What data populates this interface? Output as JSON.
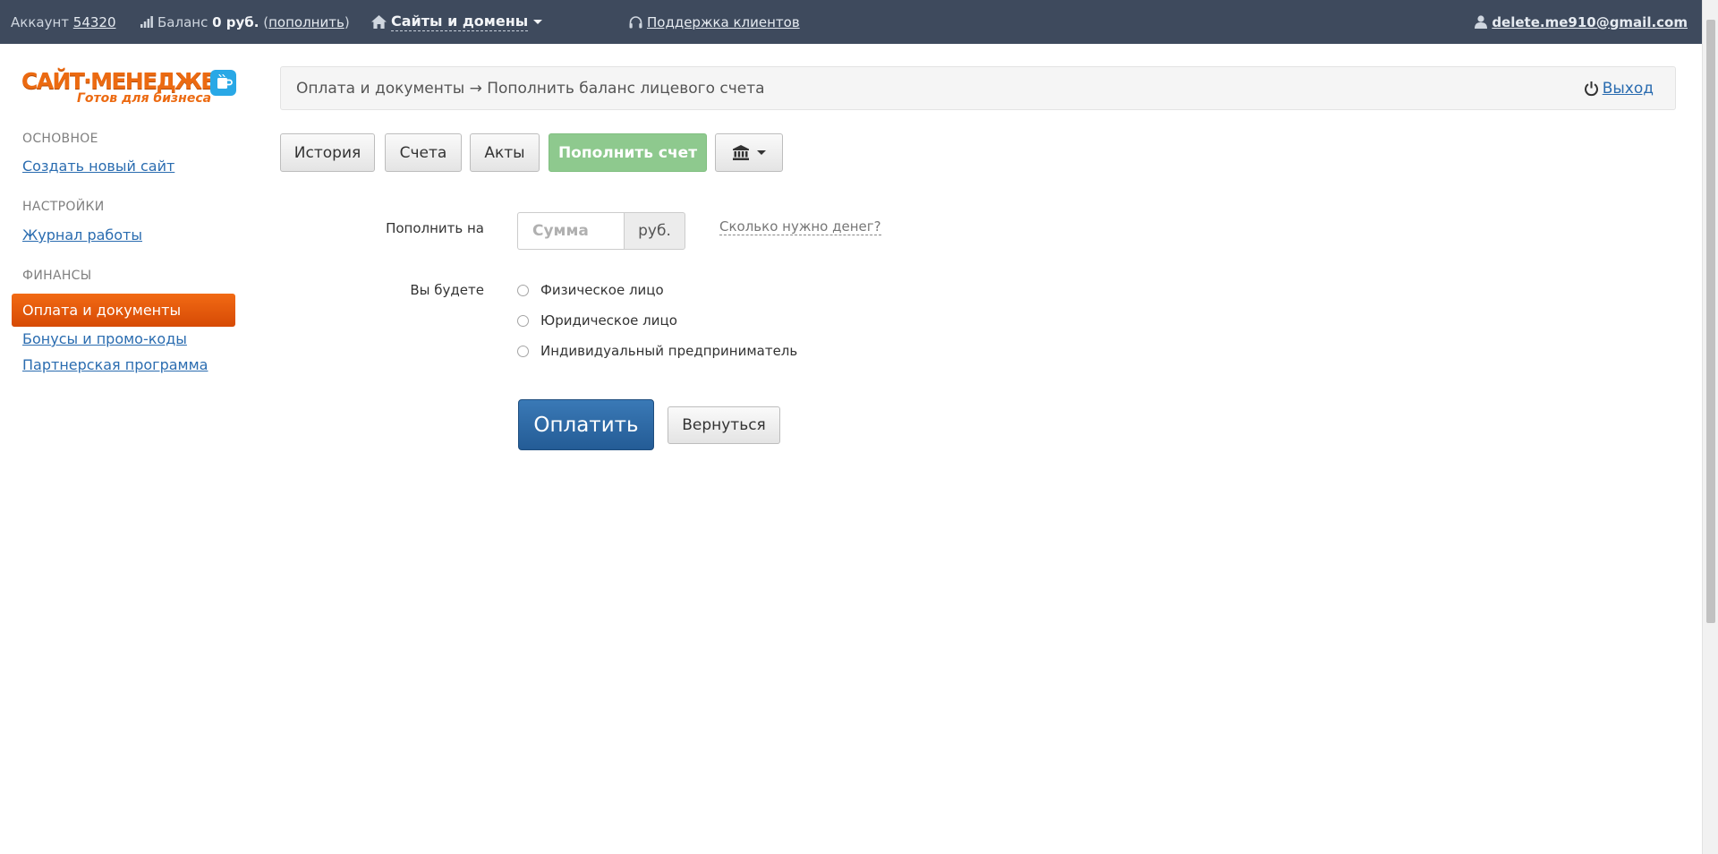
{
  "topbar": {
    "account_label": "Аккаунт",
    "account_number": "54320",
    "balance_label": "Баланс",
    "balance_value": "0 руб.",
    "topup_open": "(",
    "topup_link": "пополнить",
    "topup_close": ")",
    "sites_menu": "Сайты и домены",
    "support_link": "Поддержка клиентов",
    "user_email": "delete.me910@gmail.com"
  },
  "sidebar": {
    "logo_main": "САЙТ·МЕНЕДЖЕР",
    "logo_sub": "Готов для бизнеса",
    "sections": [
      {
        "title": "ОСНОВНОЕ",
        "items": [
          "Создать новый сайт"
        ]
      },
      {
        "title": "НАСТРОЙКИ",
        "items": [
          "Журнал работы"
        ]
      },
      {
        "title": "ФИНАНСЫ",
        "items": [
          "Оплата и документы",
          "Бонусы и промо-коды",
          "Партнерская программа"
        ]
      }
    ],
    "active_item": "Оплата и документы"
  },
  "breadcrumb": {
    "text": "Оплата и документы → Пополнить баланс лицевого счета",
    "exit_label": "Выход"
  },
  "toolbar": {
    "history": "История",
    "invoices": "Счета",
    "acts": "Акты",
    "topup": "Пополнить счет"
  },
  "form": {
    "amount_label": "Пополнить на",
    "amount_placeholder": "Сумма",
    "amount_value": "",
    "currency": "руб.",
    "help_link": "Сколько нужно денег?",
    "entity_label": "Вы будете",
    "entity_options": [
      "Физическое лицо",
      "Юридическое лицо",
      "Индивидуальный предприниматель"
    ],
    "selected_entity": null,
    "pay_button": "Оплатить",
    "back_button": "Вернуться"
  },
  "colors": {
    "topbar_bg": "#3e4a5d",
    "accent_orange": "#ec6a11",
    "link_blue": "#2a6cb0",
    "success_green": "#8ec98e",
    "primary_blue": "#2d6aa8"
  },
  "icons": {
    "balance": "signal-bars-icon",
    "sites": "home-icon",
    "support": "headphones-icon",
    "user": "user-icon",
    "logo": "cup-icon",
    "exit": "power-icon",
    "bank": "bank-icon",
    "dropdown": "chevron-down-icon"
  }
}
